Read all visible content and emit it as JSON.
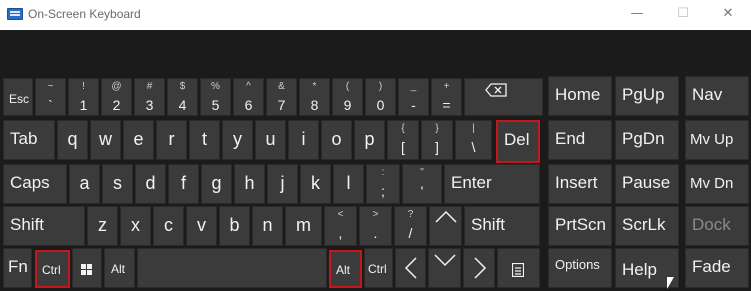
{
  "window": {
    "title": "On-Screen Keyboard",
    "minimize": "—",
    "maximize": "☐",
    "close": "✕"
  },
  "row1": {
    "esc": "Esc",
    "backtick_top": "~",
    "backtick_bot": "`",
    "k1_top": "!",
    "k1_bot": "1",
    "k2_top": "@",
    "k2_bot": "2",
    "k3_top": "#",
    "k3_bot": "3",
    "k4_top": "$",
    "k4_bot": "4",
    "k5_top": "%",
    "k5_bot": "5",
    "k6_top": "^",
    "k6_bot": "6",
    "k7_top": "&",
    "k7_bot": "7",
    "k8_top": "*",
    "k8_bot": "8",
    "k9_top": "(",
    "k9_bot": "9",
    "k0_top": ")",
    "k0_bot": "0",
    "minus_top": "_",
    "minus_bot": "-",
    "equals_top": "+",
    "equals_bot": "=",
    "backspace_icon": "backspace-icon"
  },
  "row2": {
    "tab": "Tab",
    "q": "q",
    "w": "w",
    "e": "e",
    "r": "r",
    "t": "t",
    "y": "y",
    "u": "u",
    "i": "i",
    "o": "o",
    "p": "p",
    "lbracket_top": "{",
    "lbracket_bot": "[",
    "rbracket_top": "}",
    "rbracket_bot": "]",
    "backslash_top": "|",
    "backslash_bot": "\\",
    "del": "Del"
  },
  "row3": {
    "caps": "Caps",
    "a": "a",
    "s": "s",
    "d": "d",
    "f": "f",
    "g": "g",
    "h": "h",
    "j": "j",
    "k": "k",
    "l": "l",
    "semicolon_top": ":",
    "semicolon_bot": ";",
    "quote_top": "\"",
    "quote_bot": "'",
    "enter": "Enter"
  },
  "row4": {
    "shift_left": "Shift",
    "z": "z",
    "x": "x",
    "c": "c",
    "v": "v",
    "b": "b",
    "n": "n",
    "m": "m",
    "comma_top": "<",
    "comma_bot": ",",
    "period_top": ">",
    "period_bot": ".",
    "slash_top": "?",
    "slash_bot": "/",
    "up_icon": "arrow-up-icon",
    "shift_right": "Shift"
  },
  "row5": {
    "fn": "Fn",
    "ctrl_left": "Ctrl",
    "win_icon": "windows-logo-icon",
    "alt_left": "Alt",
    "alt_right": "Alt",
    "ctrl_right": "Ctrl",
    "left_icon": "arrow-left-icon",
    "down_icon": "arrow-down-icon",
    "right_icon": "arrow-right-icon",
    "menu_icon": "context-menu-icon"
  },
  "nav": {
    "home": "Home",
    "pgup": "PgUp",
    "end": "End",
    "pgdn": "PgDn",
    "insert": "Insert",
    "pause": "Pause",
    "prtscn": "PrtScn",
    "scrlk": "ScrLk",
    "options": "Options",
    "help": "Help"
  },
  "side": {
    "nav": "Nav",
    "mvup": "Mv Up",
    "mvdn": "Mv Dn",
    "dock": "Dock",
    "fade": "Fade"
  },
  "colors": {
    "key_bg": "#3b3b3b",
    "board_bg": "#1b1b1b",
    "highlight": "#c8141c",
    "title_bg": "#ffffff"
  }
}
